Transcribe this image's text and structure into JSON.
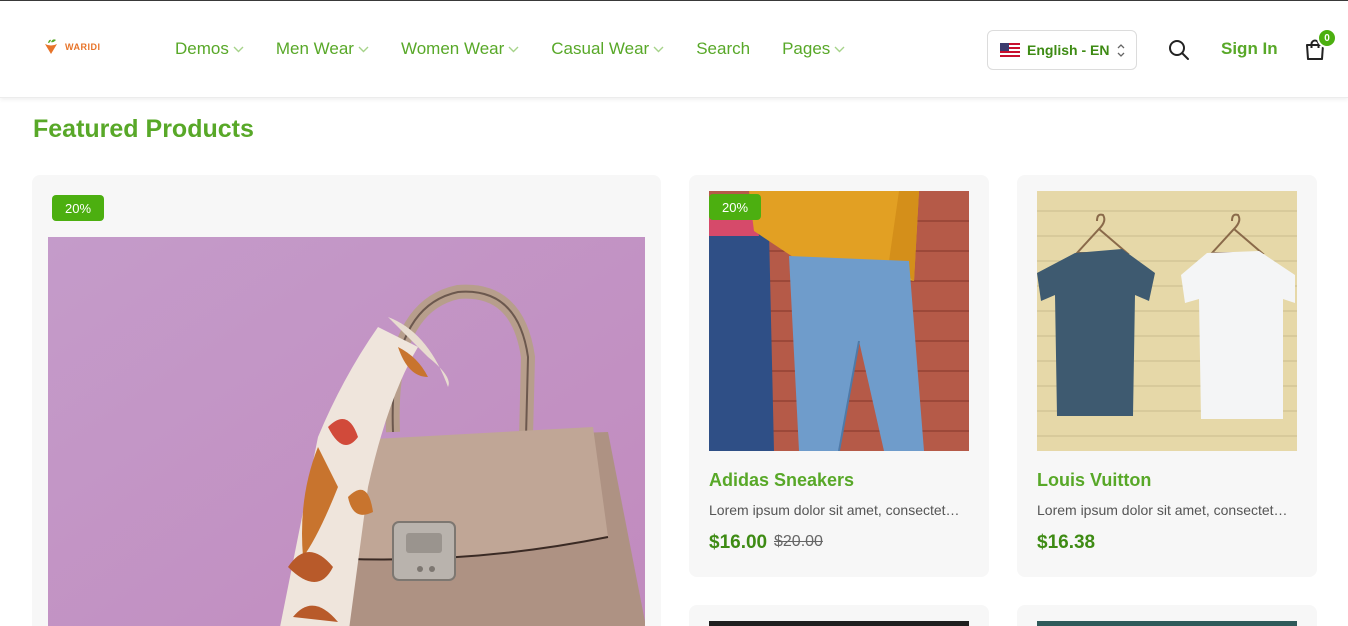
{
  "brand": {
    "name": "WARIDI"
  },
  "nav": [
    {
      "label": "Demos",
      "dropdown": true
    },
    {
      "label": "Men Wear",
      "dropdown": true
    },
    {
      "label": "Women Wear",
      "dropdown": true
    },
    {
      "label": "Casual Wear",
      "dropdown": true
    },
    {
      "label": "Search",
      "dropdown": false
    },
    {
      "label": "Pages",
      "dropdown": true
    }
  ],
  "language": {
    "label": "English - EN",
    "flag": "us-flag-icon"
  },
  "actions": {
    "signin_label": "Sign In",
    "cart_count": "0"
  },
  "section": {
    "title": "Featured Products"
  },
  "products": {
    "featured": {
      "badge": "20%",
      "image": "handbag-with-scarf-image"
    },
    "adidas": {
      "badge": "20%",
      "title": "Adidas Sneakers",
      "desc": "Lorem ipsum dolor sit amet, consectetur adipiscing elit.",
      "price": "$16.00",
      "old_price": "$20.00",
      "image": "jeans-couple-image"
    },
    "louis": {
      "title": "Louis Vuitton",
      "desc": "Lorem ipsum dolor sit amet, consectetur adipiscing elit.",
      "price": "$16.38",
      "image": "tshirts-on-hangers-image"
    }
  },
  "colors": {
    "accent": "#58a828",
    "badge": "#4caf10",
    "logo": "#e7742a"
  }
}
